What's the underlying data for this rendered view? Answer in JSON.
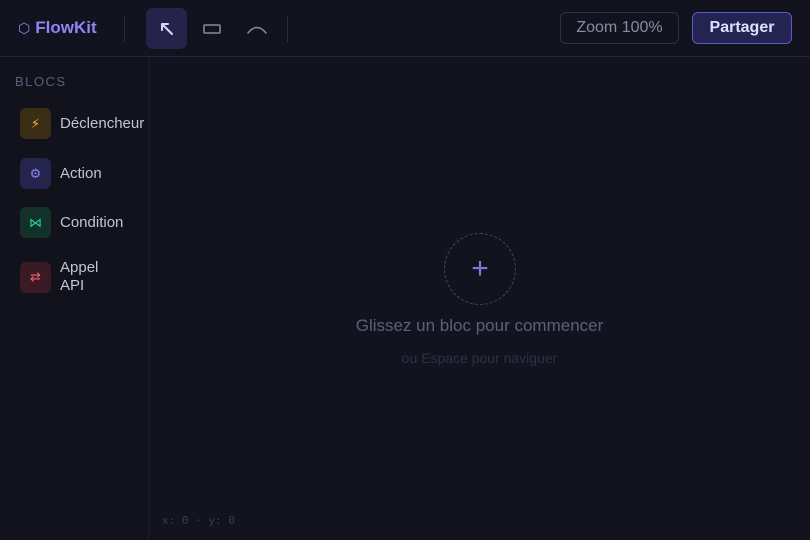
{
  "app": {
    "brand_icon": "⬡",
    "brand_name": "FlowKit"
  },
  "toolbar": {
    "tools": [
      {
        "name": "select-tool",
        "icon": "cursor-arrow-icon",
        "active": true
      },
      {
        "name": "rectangle-tool",
        "icon": "rectangle-icon",
        "active": false
      },
      {
        "name": "connector-tool",
        "icon": "curve-icon",
        "active": false
      }
    ],
    "zoom_label": "Zoom 100%",
    "share_label": "Partager"
  },
  "sidebar": {
    "title": "BLOCS",
    "blocks": [
      {
        "label": "Déclencheur",
        "icon": "lightning-icon",
        "glyph": "⚡",
        "color": "#f3b52c"
      },
      {
        "label": "Action",
        "icon": "gear-icon",
        "glyph": "⚙",
        "color": "#8b84f6"
      },
      {
        "label": "Condition",
        "icon": "bowtie-icon",
        "glyph": "⋈",
        "color": "#2ed0a0"
      },
      {
        "label": "Appel API",
        "icon": "swap-arrows-icon",
        "glyph": "⇄",
        "color": "#f0646e"
      }
    ]
  },
  "canvas": {
    "add_glyph": "+",
    "hint_main": "Glissez un bloc pour commencer",
    "hint_sub": "ou Espace pour naviguer",
    "coords": "x: 0 · y: 0"
  },
  "colors": {
    "accent": "#8f86f5",
    "background": "#13131f"
  }
}
